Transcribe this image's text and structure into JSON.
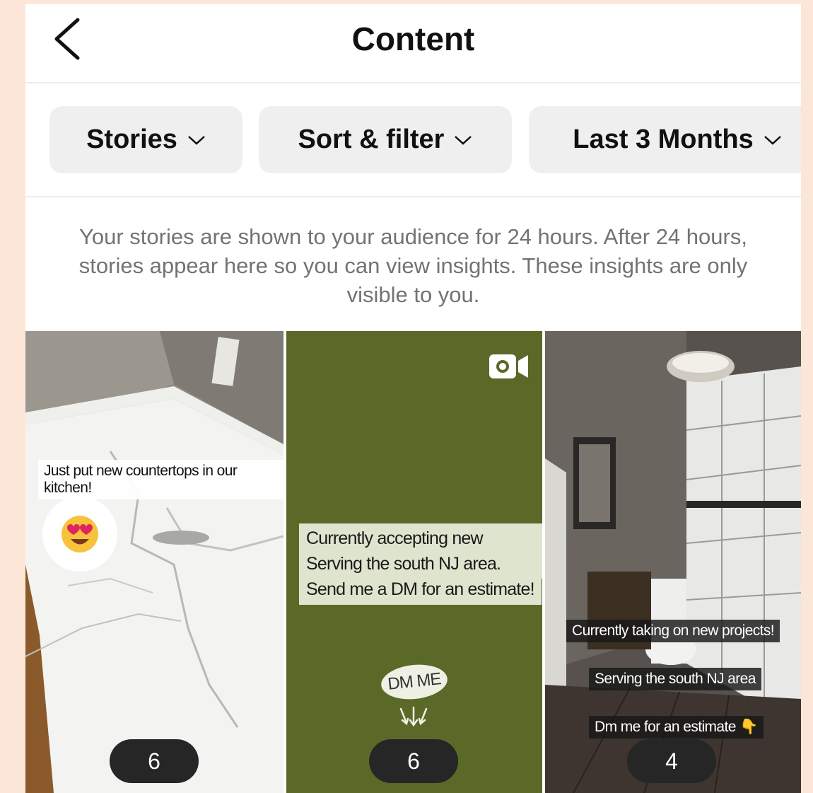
{
  "header": {
    "title": "Content"
  },
  "filters": {
    "type_label": "Stories",
    "sort_label": "Sort & filter",
    "range_label": "Last 3 Months"
  },
  "info_text": "Your stories are shown to your audience for 24 hours. After 24 hours, stories appear here so you can view insights. These insights are only visible to you.",
  "stories": [
    {
      "captions": [
        "Just put new countertops in our kitchen!"
      ],
      "sticker": "heart-eyes-emoji",
      "views": "6"
    },
    {
      "captions": [
        "Currently accepting new projects!",
        "Serving the south NJ area.",
        "Send me a DM for an estimate!"
      ],
      "badge": "DM ME",
      "views": "6",
      "media": "video-icon"
    },
    {
      "captions": [
        "Currently taking on new projects!",
        "Serving the south NJ area",
        "Dm me for an estimate 👇"
      ],
      "views": "4"
    }
  ],
  "colors": {
    "background": "#fbe6d8",
    "chip": "#efefef",
    "story_green": "#5b6928",
    "views_pill": "#262626"
  }
}
